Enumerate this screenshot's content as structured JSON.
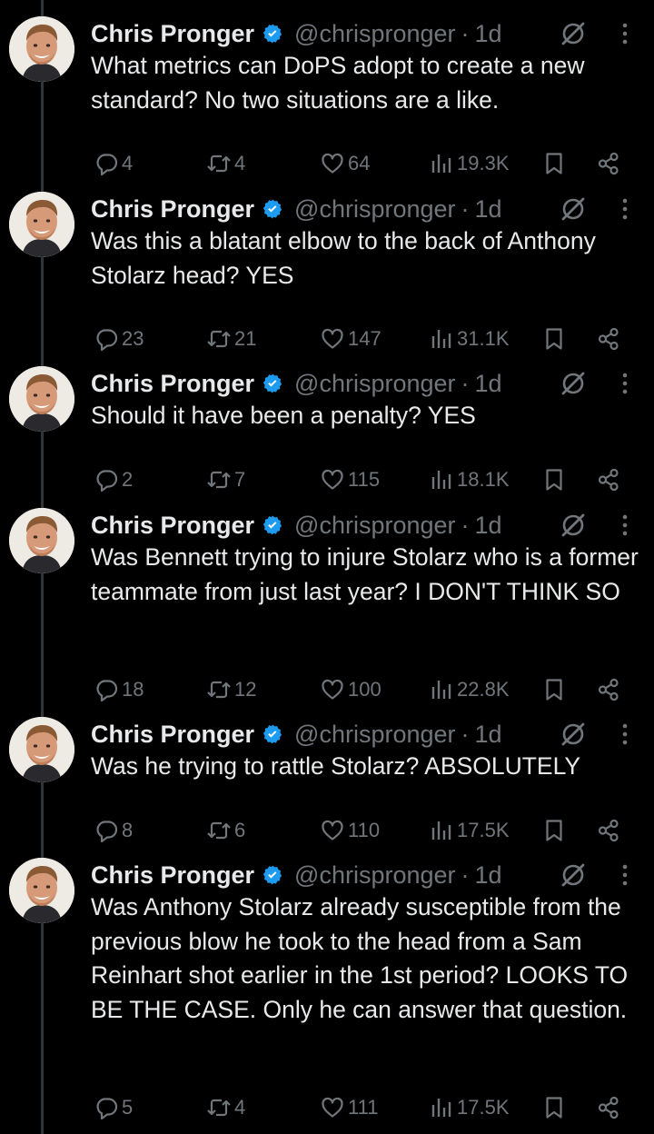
{
  "author": {
    "name": "Chris Pronger",
    "handle": "@chrispronger",
    "time": "1d"
  },
  "tweets": [
    {
      "text": "What metrics can DoPS adopt to create a new standard? No two situations are a like.",
      "replies": "4",
      "retweets": "4",
      "likes": "64",
      "views": "19.3K"
    },
    {
      "text": "Was this a blatant elbow to the back of Anthony Stolarz head? YES",
      "replies": "23",
      "retweets": "21",
      "likes": "147",
      "views": "31.1K"
    },
    {
      "text": "Should it have been a penalty? YES",
      "replies": "2",
      "retweets": "7",
      "likes": "115",
      "views": "18.1K"
    },
    {
      "text": "Was Bennett trying to injure Stolarz who is a former teammate from just last year? I DON'T THINK SO",
      "replies": "18",
      "retweets": "12",
      "likes": "100",
      "views": "22.8K"
    },
    {
      "text": "Was he trying to rattle Stolarz? ABSOLUTELY",
      "replies": "8",
      "retweets": "6",
      "likes": "110",
      "views": "17.5K"
    },
    {
      "text": "Was Anthony Stolarz already susceptible from the previous blow he took to the head from a Sam Reinhart shot earlier in the 1st period? LOOKS TO BE THE CASE. Only he can answer that question.",
      "replies": "5",
      "retweets": "4",
      "likes": "111",
      "views": "17.5K"
    }
  ],
  "icons": {
    "reply": "reply-icon",
    "retweet": "retweet-icon",
    "like": "heart-icon",
    "views": "views-icon",
    "bookmark": "bookmark-icon",
    "share": "share-icon",
    "grok": "grok-icon",
    "more": "more-icon",
    "verified": "verified-badge-icon"
  },
  "colors": {
    "background": "#000000",
    "text": "#e7e9ea",
    "muted": "#71767b",
    "verified": "#1d9bf0"
  }
}
